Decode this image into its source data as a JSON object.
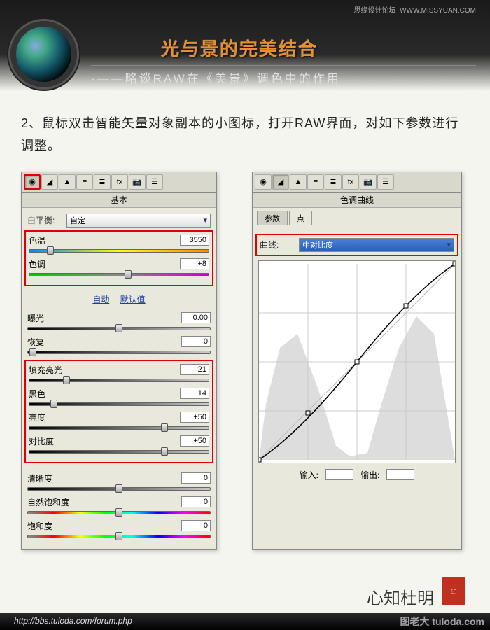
{
  "site": {
    "name": "思缘设计论坛",
    "url": "WWW.MISSYUAN.COM"
  },
  "header": {
    "title": "光与景的完美结合",
    "subtitle": "·——略谈RAW在《美景》调色中的作用"
  },
  "instruction": "2、鼠标双击智能矢量对象副本的小图标，打开RAW界面，对如下参数进行调整。",
  "basic_panel": {
    "title": "基本",
    "wb_label": "白平衡:",
    "wb_value": "自定",
    "links": {
      "auto": "自动",
      "default": "默认值"
    },
    "group1": [
      {
        "label": "色温",
        "value": "3550",
        "pos": 12,
        "bar": "bar-temp"
      },
      {
        "label": "色调",
        "value": "+8",
        "pos": 55,
        "bar": "bar-tint"
      }
    ],
    "group2": [
      {
        "label": "曝光",
        "value": "0.00",
        "pos": 50,
        "bar": "bar-gray"
      },
      {
        "label": "恢复",
        "value": "0",
        "pos": 3,
        "bar": "bar-gray"
      }
    ],
    "group3": [
      {
        "label": "填充亮光",
        "value": "21",
        "pos": 21,
        "bar": "bar-gray"
      },
      {
        "label": "黑色",
        "value": "14",
        "pos": 14,
        "bar": "bar-gray"
      },
      {
        "label": "亮度",
        "value": "+50",
        "pos": 75,
        "bar": "bar-gray"
      },
      {
        "label": "对比度",
        "value": "+50",
        "pos": 75,
        "bar": "bar-gray"
      }
    ],
    "group4": [
      {
        "label": "清晰度",
        "value": "0",
        "pos": 50,
        "bar": "bar-gray"
      },
      {
        "label": "自然饱和度",
        "value": "0",
        "pos": 50,
        "bar": "bar-sat"
      },
      {
        "label": "饱和度",
        "value": "0",
        "pos": 50,
        "bar": "bar-sat"
      }
    ]
  },
  "curves_panel": {
    "title": "色调曲线",
    "tabs": [
      "参数",
      "点"
    ],
    "curve_label": "曲线:",
    "curve_value": "中对比度",
    "input_label": "输入:",
    "output_label": "输出:"
  },
  "footer": {
    "url": "http://bbs.tuloda.com/forum.php"
  },
  "signature": "心知杜明",
  "watermark": "图老大 tuloda.com"
}
